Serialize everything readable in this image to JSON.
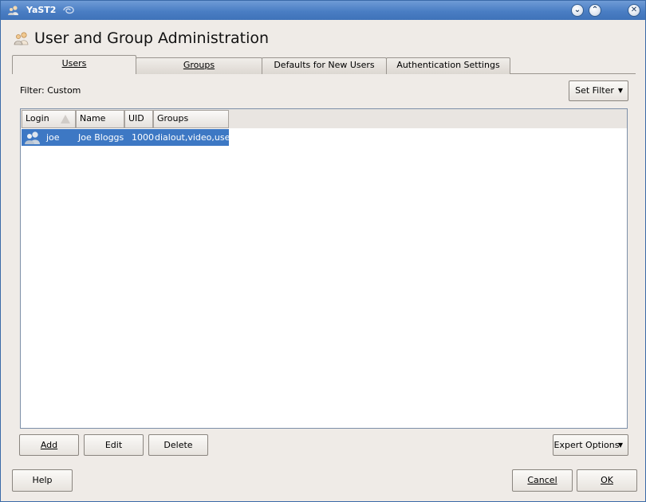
{
  "window": {
    "title": "YaST2"
  },
  "header": {
    "title": "User and Group Administration"
  },
  "tabs": [
    {
      "label": "Users",
      "active": true
    },
    {
      "label": "Groups",
      "active": false
    },
    {
      "label": "Defaults for New Users",
      "active": false
    },
    {
      "label": "Authentication Settings",
      "active": false
    }
  ],
  "filter": {
    "label": "Filter: Custom",
    "button": "Set Filter"
  },
  "table": {
    "columns": [
      "Login",
      "Name",
      "UID",
      "Groups"
    ],
    "rows": [
      {
        "login": "joe",
        "name": "Joe Bloggs",
        "uid": "1000",
        "groups": "dialout,video,users",
        "selected": true,
        "icon": "users-icon"
      }
    ]
  },
  "actions": {
    "add": "Add",
    "edit": "Edit",
    "delete": "Delete",
    "expert": "Expert Options"
  },
  "footer": {
    "help": "Help",
    "cancel": "Cancel",
    "ok": "OK"
  },
  "colors": {
    "titlebar": "#4a7ec4",
    "selection": "#3d78c4",
    "window_bg": "#efebe7"
  }
}
